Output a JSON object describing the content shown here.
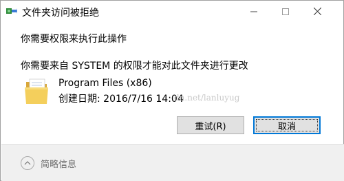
{
  "window": {
    "title": "文件夹访问被拒绝",
    "minimize_label": "—",
    "maximize_label": "☐",
    "close_label": "✕"
  },
  "dialog": {
    "heading": "你需要权限来执行此操作",
    "message": "你需要来自 SYSTEM 的权限才能对此文件夹进行更改",
    "item": {
      "name": "Program Files (x86)",
      "created": "创建日期: 2016/7/16 14:04",
      "icon": "folder-icon"
    },
    "watermark": "dn.net/lanluyug",
    "buttons": {
      "retry": "重试(R)",
      "cancel": "取消"
    }
  },
  "footer": {
    "details_label": "简略信息"
  },
  "colors": {
    "accent": "#0078d7",
    "button_bg": "#e1e1e1",
    "footer_bg": "#f0f0f0"
  }
}
